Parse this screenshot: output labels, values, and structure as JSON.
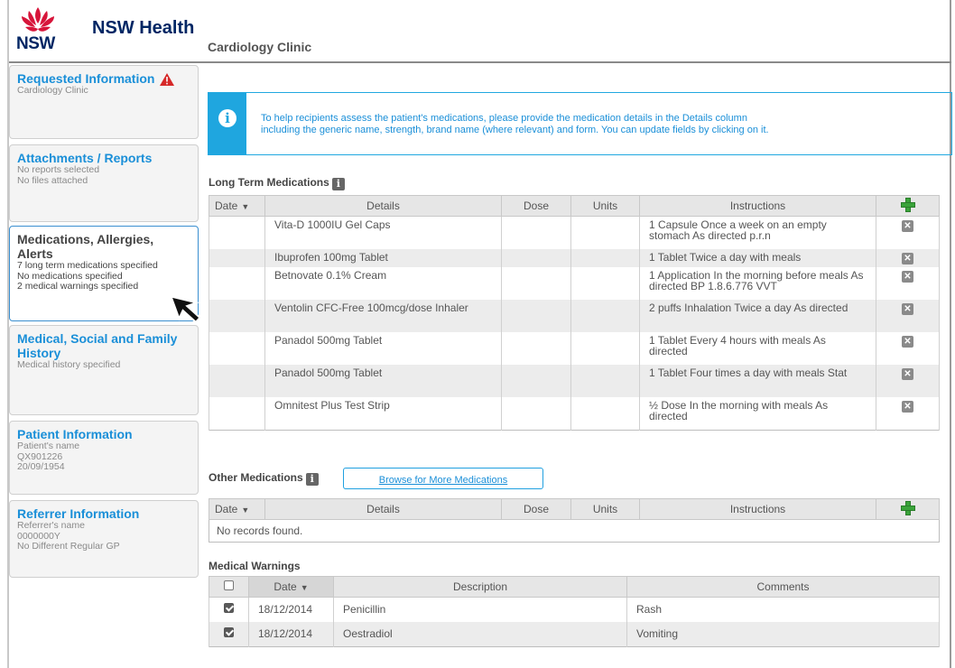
{
  "header": {
    "logo_text": "NSW",
    "brand": "NSW Health",
    "clinic": "Cardiology Clinic"
  },
  "sidebar": [
    {
      "title": "Requested Information",
      "lines": [
        "Cardiology Clinic"
      ]
    },
    {
      "title": "Attachments / Reports",
      "lines": [
        "No reports selected",
        "No files attached"
      ]
    },
    {
      "title": "Medications, Allergies, Alerts",
      "lines": [
        "7 long term medications specified",
        "No medications specified",
        "2 medical warnings specified"
      ]
    },
    {
      "title": "Medical, Social and Family History",
      "lines": [
        "Medical history specified"
      ]
    },
    {
      "title": "Patient Information",
      "lines": [
        "Patient's name",
        "QX901226",
        "20/09/1954"
      ]
    },
    {
      "title": "Referrer Information",
      "lines": [
        "Referrer's name",
        "0000000Y",
        "No Different Regular GP"
      ]
    }
  ],
  "info": {
    "line1": "To help recipients assess the patient's medications, please provide the medication details in the Details column",
    "line2": "including the generic name, strength, brand name (where relevant) and form. You can update fields by clicking on it."
  },
  "long_term": {
    "title": "Long Term Medications",
    "headers": [
      "Date",
      "Details",
      "Dose",
      "Units",
      "Instructions"
    ],
    "rows": [
      {
        "date": "",
        "details": "Vita-D 1000IU Gel Caps",
        "dose": "",
        "units": "",
        "instructions": "1 Capsule Once a week on an empty stomach As directed p.r.n"
      },
      {
        "date": "",
        "details": "Ibuprofen 100mg Tablet",
        "dose": "",
        "units": "",
        "instructions": "1 Tablet Twice a day with meals"
      },
      {
        "date": "",
        "details": "Betnovate 0.1% Cream",
        "dose": "",
        "units": "",
        "instructions": "1 Application In the morning before meals As directed BP 1.8.6.776 VVT"
      },
      {
        "date": "",
        "details": "Ventolin CFC-Free 100mcg/dose Inhaler",
        "dose": "",
        "units": "",
        "instructions": "2 puffs Inhalation Twice a day As directed"
      },
      {
        "date": "",
        "details": "Panadol 500mg Tablet",
        "dose": "",
        "units": "",
        "instructions": "1 Tablet Every 4 hours with meals As directed"
      },
      {
        "date": "",
        "details": "Panadol 500mg Tablet",
        "dose": "",
        "units": "",
        "instructions": "1 Tablet Four times a day with meals Stat"
      },
      {
        "date": "",
        "details": "Omnitest Plus Test Strip",
        "dose": "",
        "units": "",
        "instructions": "½ Dose In the morning with meals As directed"
      }
    ]
  },
  "other": {
    "title": "Other Medications",
    "browse_label": "Browse for More Medications",
    "headers": [
      "Date",
      "Details",
      "Dose",
      "Units",
      "Instructions"
    ],
    "empty": "No records found."
  },
  "warnings": {
    "title": "Medical Warnings",
    "headers": [
      "Date",
      "Description",
      "Comments"
    ],
    "rows": [
      {
        "date": "18/12/2014",
        "description": "Penicillin",
        "comments": "Rash",
        "checked": true
      },
      {
        "date": "18/12/2014",
        "description": "Oestradiol",
        "comments": "Vomiting",
        "checked": true
      }
    ]
  },
  "colors": {
    "brand": "#002664",
    "accent": "#1fa6df",
    "warning": "#d62828"
  }
}
